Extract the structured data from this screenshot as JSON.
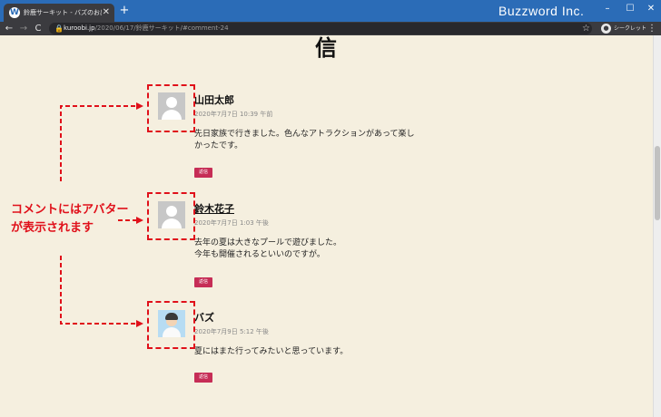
{
  "browser": {
    "tab_favicon": "W",
    "tab_title": "鈴鹿サーキット - バズのお出かけブログ",
    "tab_close": "✕",
    "new_tab": "+",
    "brand": "Buzzword Inc.",
    "window_controls": {
      "minimize": "–",
      "maximize": "☐",
      "close": "✕"
    },
    "nav": {
      "back": "←",
      "forward": "→",
      "reload": "C"
    },
    "url_host": "kuroobi.jp",
    "url_path": "/2020/06/17/鈴鹿サーキット/#comment-24",
    "star_icon": "☆",
    "incognito_label": "シークレット",
    "menu_icon": "⋮"
  },
  "page": {
    "heading": "信",
    "callout_line1": "コメントにはアバター",
    "callout_line2": "が表示されます",
    "accent_color": "#e0101a",
    "reply_color": "#c62d56",
    "comments": [
      {
        "author": "山田太郎",
        "date": "2020年7月7日 10:39 午前",
        "text_line1": "先日家族で行きました。色んなアトラクションがあって楽し",
        "text_line2": "かったです。",
        "reply_label": "返信",
        "avatar_icon": "default-avatar-icon"
      },
      {
        "author": "鈴木花子",
        "date": "2020年7月7日 1:03 午後",
        "text_line1": "去年の夏は大きなプールで遊びました。",
        "text_line2": "今年も開催されるといいのですが。",
        "reply_label": "返信",
        "avatar_icon": "default-avatar-icon"
      },
      {
        "author": "バズ",
        "date": "2020年7月9日 5:12 午後",
        "text_line1": "夏にはまた行ってみたいと思っています。",
        "reply_label": "返信",
        "avatar_icon": "custom-avatar-icon"
      }
    ]
  }
}
